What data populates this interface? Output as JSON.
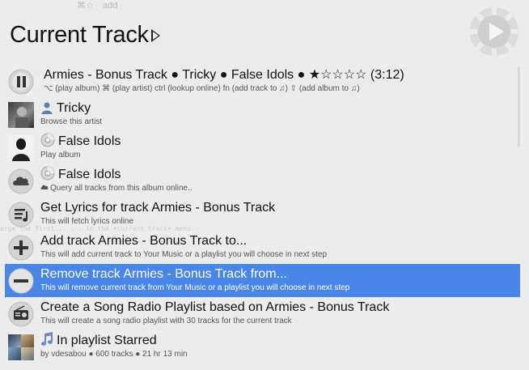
{
  "top_strip": {
    "text1": "⌘☆",
    "text2": "add"
  },
  "header": {
    "title": "Current Track"
  },
  "rows": [
    {
      "title": "Armies - Bonus Track ● Tricky ● False Idols ● ★☆☆☆☆ (3:12)",
      "subtitle": "⌥ (play album) ⌘ (play artist) ctrl (lookup online) fn (add track to ♫) ⇧ (add album to ♫)"
    },
    {
      "title": "Tricky",
      "subtitle": "Browse this artist"
    },
    {
      "title": "False Idols",
      "subtitle": "Play album"
    },
    {
      "title": "False Idols",
      "subtitle": "Query all tracks from this album online.."
    },
    {
      "title": "Get Lyrics for track Armies - Bonus Track",
      "subtitle": "This will fetch lyrics online"
    },
    {
      "title": "Add track Armies - Bonus Track to...",
      "subtitle": "This will add current track to Your Music or a playlist you will choose in next step"
    },
    {
      "title": "Remove track Armies - Bonus Track from...",
      "subtitle": "This will remove current track from Your Music or a playlist you will choose in next step"
    },
    {
      "title": "Create a Song Radio Playlist based on Armies - Bonus Track",
      "subtitle": "This will create a song radio playlist with 30 tracks for the current track"
    },
    {
      "title": "In playlist Starred",
      "subtitle": "by vdesabou ● 600 tracks ● 21 hr 13 min"
    }
  ],
  "colors": {
    "selection": "#4a86e8",
    "background": "#ececec",
    "icon_gray": "#555555"
  },
  "selected_index": 6
}
